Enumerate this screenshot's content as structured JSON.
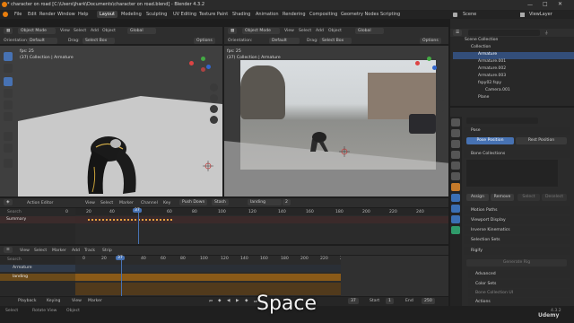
{
  "window": {
    "title": "* character on road [C:\\Users\\jhark\\Documents\\character on road.blend] - Blender 4.3.2"
  },
  "menubar": {
    "items": [
      "File",
      "Edit",
      "Render",
      "Window",
      "Help"
    ],
    "workspaces": [
      "Layout",
      "Modeling",
      "Sculpting",
      "UV Editing",
      "Texture Paint",
      "Shading",
      "Animation",
      "Rendering",
      "Compositing",
      "Geometry Nodes",
      "Scripting"
    ],
    "scene": "Scene",
    "view_layer": "ViewLayer"
  },
  "viewport_left": {
    "mode": "Object Mode",
    "menus": [
      "View",
      "Select",
      "Add",
      "Object"
    ],
    "transform": "Global",
    "orientation_label": "Orientation:",
    "orientation": "Default",
    "drag_label": "Drag:",
    "drag": "Select Box",
    "options": "Options",
    "fps": "fps: 25",
    "collection": "(37) Collection | Armature"
  },
  "viewport_right": {
    "mode": "Object Mode",
    "menus": [
      "View",
      "Select",
      "Add",
      "Object"
    ],
    "transform": "Global",
    "orientation_label": "Orientation:",
    "orientation": "Default",
    "drag_label": "Drag:",
    "drag": "Select Box",
    "options": "Options",
    "fps": "fps: 25",
    "collection": "(37) Collection | Armature"
  },
  "action_editor": {
    "type": "Action Editor",
    "menus": [
      "View",
      "Select",
      "Marker",
      "Channel",
      "Key"
    ],
    "push_down": "Push Down",
    "stash": "Stash",
    "action": "landing",
    "users": "2",
    "search_placeholder": "Search",
    "summary": "Summary",
    "current_frame": "37",
    "ruler": [
      "0",
      "20",
      "40",
      "60",
      "80",
      "100",
      "120",
      "140",
      "160",
      "180",
      "200",
      "220",
      "240"
    ]
  },
  "nla_editor": {
    "menus": [
      "View",
      "Select",
      "Marker",
      "Add",
      "Track",
      "Strip"
    ],
    "search_placeholder": "Search",
    "tracks": [
      "Armature",
      "landing"
    ],
    "current_frame": "37",
    "ruler": [
      "0",
      "20",
      "40",
      "60",
      "80",
      "100",
      "120",
      "140",
      "160",
      "180",
      "200",
      "220",
      "240",
      "260"
    ]
  },
  "playback": {
    "playback": "Playback",
    "keying": "Keying",
    "view": "View",
    "marker": "Marker",
    "frame": "37",
    "start_label": "Start",
    "start": "1",
    "end_label": "End",
    "end": "250",
    "version": "4.3.2"
  },
  "status": {
    "select": "Select",
    "rotate": "Rotate View",
    "object": "Object"
  },
  "overlay_key": "Space",
  "outliner": {
    "search_placeholder": "",
    "rows": [
      "Scene Collection",
      "Collection",
      "Armature",
      "Armature.001",
      "Armature.002",
      "Armature.003",
      "fspy02.fspy",
      "Camera.001",
      "Plane"
    ]
  },
  "properties": {
    "sections": [
      "Pose",
      "Bone Collections",
      "Motion Paths",
      "Viewport Display",
      "Inverse Kinematics",
      "Selection Sets",
      "Rigify",
      "Advanced",
      "Color Sets",
      "Bone Collection UI",
      "Actions"
    ],
    "pose_position": "Pose Position",
    "rest_position": "Rest Position",
    "bc_buttons": [
      "Assign",
      "Remove",
      "Select",
      "Deselect"
    ],
    "generate": "Generate Rig"
  },
  "watermark": "Udemy"
}
